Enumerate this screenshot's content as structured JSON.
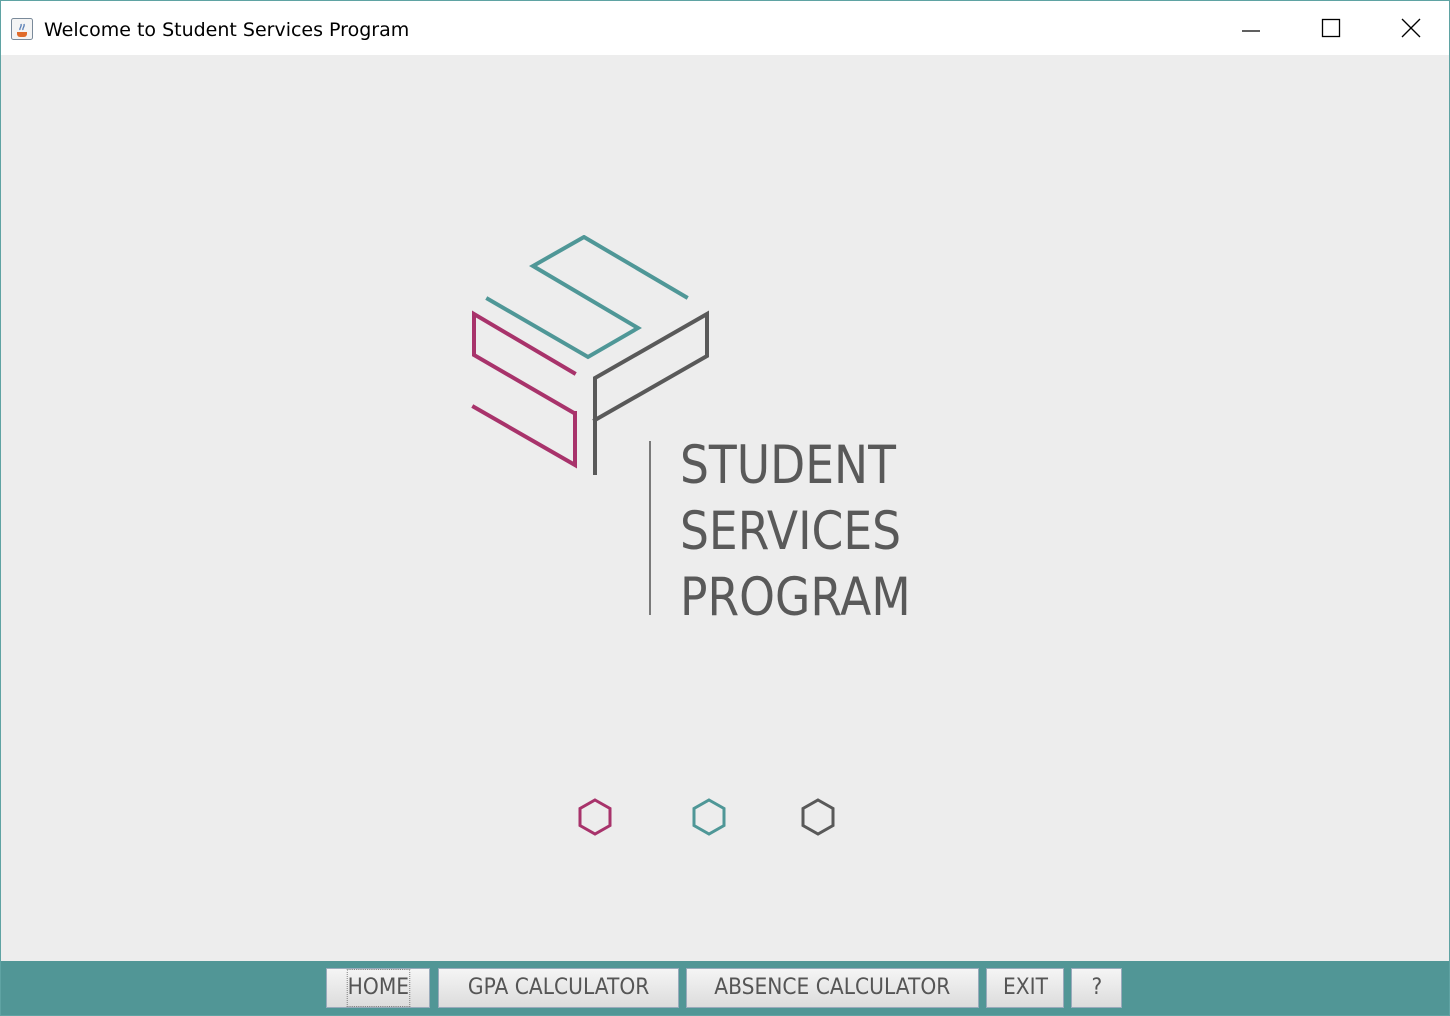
{
  "window": {
    "title": "Welcome to Student Services Program",
    "controls": [
      "minimize",
      "maximize",
      "close"
    ]
  },
  "brand": {
    "lines": [
      "STUDENT",
      "SERVICES",
      "PROGRAM"
    ]
  },
  "colors": {
    "magenta": "#a8336b",
    "teal": "#4f9797",
    "gray": "#595959",
    "navbar": "#519696",
    "background": "#ededed"
  },
  "indicators": [
    {
      "icon": "hexagon-icon",
      "color": "#a8336b"
    },
    {
      "icon": "hexagon-icon",
      "color": "#4f9797"
    },
    {
      "icon": "hexagon-icon",
      "color": "#595959"
    }
  ],
  "navbar": {
    "home": "HOME",
    "gpa": "GPA CALCULATOR",
    "absence": "ABSENCE CALCULATOR",
    "exit": "EXIT",
    "help": "?"
  }
}
